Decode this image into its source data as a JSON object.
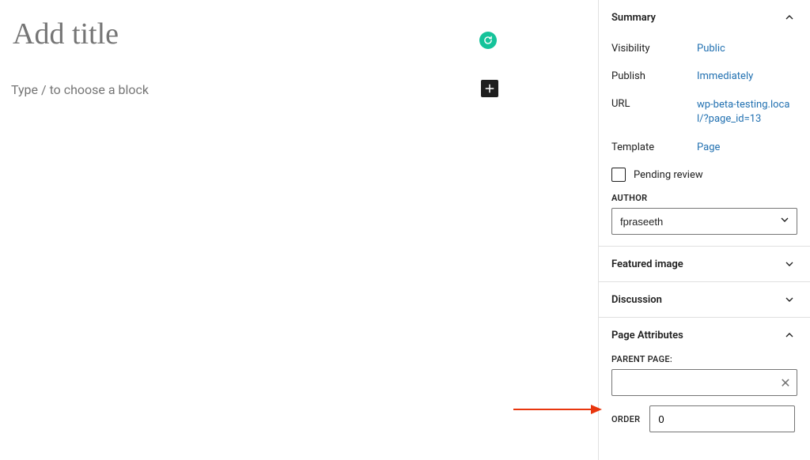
{
  "editor": {
    "title_placeholder": "Add title",
    "title_value": "",
    "block_placeholder": "Type / to choose a block"
  },
  "sidebar": {
    "summary": {
      "header": "Summary",
      "expanded": true,
      "rows": {
        "visibility": {
          "label": "Visibility",
          "value": "Public"
        },
        "publish": {
          "label": "Publish",
          "value": "Immediately"
        },
        "url": {
          "label": "URL",
          "value": "wp-beta-testing.local/?page_id=13"
        },
        "template": {
          "label": "Template",
          "value": "Page"
        }
      },
      "pending_review": {
        "label": "Pending review",
        "checked": false
      },
      "author": {
        "label": "AUTHOR",
        "value": "fpraseeth"
      }
    },
    "featured_image": {
      "header": "Featured image",
      "expanded": false
    },
    "discussion": {
      "header": "Discussion",
      "expanded": false
    },
    "page_attributes": {
      "header": "Page Attributes",
      "expanded": true,
      "parent_label": "PARENT PAGE:",
      "parent_value": "",
      "order_label": "ORDER",
      "order_value": "0"
    }
  }
}
